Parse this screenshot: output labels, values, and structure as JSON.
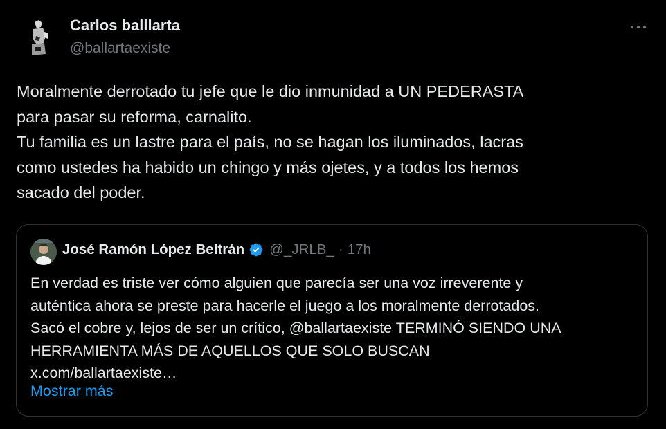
{
  "author": {
    "display_name": "Carlos balllarta",
    "handle": "@ballartaexiste"
  },
  "menu": {
    "more_icon": "more-horizontal-icon"
  },
  "tweet": {
    "lines": [
      "Moralmente derrotado tu jefe que le dio inmunidad a UN PEDERASTA",
      "para pasar su reforma, carnalito.",
      "Tu familia es un lastre para el país, no se hagan los iluminados, lacras",
      "como ustedes ha habido un chingo y más ojetes, y a todos los hemos",
      "sacado del poder."
    ]
  },
  "quoted": {
    "display_name": "José Ramón López Beltrán",
    "verified_icon": "verified-badge-icon",
    "handle": "@_JRLB_",
    "dot": "·",
    "time": "17h",
    "lines": [
      "En verdad es triste ver cómo alguien que parecía ser una voz irreverente y",
      "auténtica ahora se preste para hacerle el juego a los moralmente derrotados.",
      "Sacó el cobre y, lejos de ser un crítico, @ballartaexiste TERMINÓ SIENDO UNA",
      "HERRAMIENTA MÁS DE AQUELLOS QUE SOLO BUSCAN",
      "x.com/ballartaexiste…"
    ],
    "show_more": "Mostrar más"
  },
  "colors": {
    "background": "#000000",
    "text": "#e7e9ea",
    "secondary": "#71767b",
    "link": "#1d9bf0",
    "border": "#2f3336"
  }
}
